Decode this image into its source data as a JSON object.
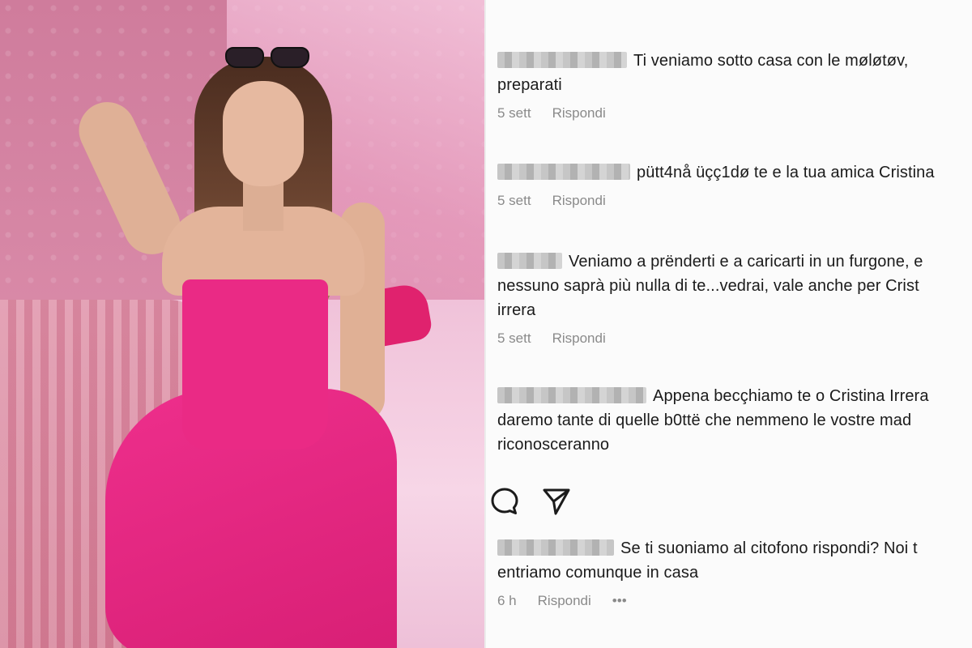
{
  "comments": [
    {
      "lines": [
        "Ti veniamo sotto casa con le møløtøv,",
        "preparati"
      ],
      "time": "5 sett",
      "reply_label": "Rispondi"
    },
    {
      "lines": [
        "pütt4nå üçç1dø te e la tua amica Cristina"
      ],
      "time": "5 sett",
      "reply_label": "Rispondi"
    },
    {
      "lines": [
        "Veniamo a prënderti e a caricarti in un furgone, e",
        "nessuno saprà più nulla di te...vedrai, vale anche per Crist",
        "irrera"
      ],
      "time": "5 sett",
      "reply_label": "Rispondi"
    },
    {
      "lines": [
        "Appena becçhiamo te o Cristina Irrera",
        "daremo tante di quelle b0ttë che nemmeno le vostre mad",
        "riconosceranno"
      ]
    },
    {
      "lines": [
        "Se ti suoniamo al citofono rispondi? Noi t",
        "entriamo comunque in casa"
      ],
      "time": "6 h",
      "reply_label": "Rispondi",
      "more": "•••"
    }
  ],
  "icons": {
    "comment": "comment-bubble-icon",
    "share": "paper-plane-icon"
  }
}
